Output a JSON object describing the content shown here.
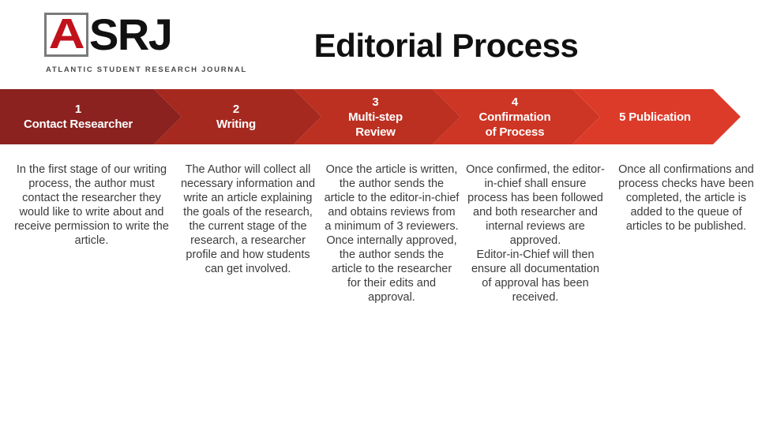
{
  "header": {
    "logo": {
      "letter_box": "A",
      "wordmark": "SRJ",
      "subtitle": "ATLANTIC STUDENT RESEARCH JOURNAL",
      "box_letter_color": "#C1121C",
      "wordmark_color": "#111111",
      "box_border_color": "#7A7A7A"
    },
    "title": "Editorial Process"
  },
  "process": {
    "steps": [
      {
        "number": "1",
        "title": "Contact Researcher",
        "header_text": "1\nContact Researcher",
        "color": "#8B2220",
        "body": "In the first stage of our writing process, the author must contact the researcher they would like to write about and receive permission to write the article."
      },
      {
        "number": "2",
        "title": "Writing",
        "header_text": "2\nWriting",
        "color": "#A5291F",
        "body": "The Author will collect all necessary information and write an article explaining the goals of the research, the current stage of the research, a researcher profile and how students can get involved."
      },
      {
        "number": "3",
        "title": "Multi-step Review",
        "header_text": "3\nMulti-step\nReview",
        "color": "#BB3021",
        "body": "Once the article is written, the author sends the article to the editor-in-chief and obtains reviews from a minimum of 3 reviewers. Once internally approved, the author sends the article to the researcher for their edits and approval."
      },
      {
        "number": "4",
        "title": "Confirmation of Process",
        "header_text": "4\nConfirmation\nof Process",
        "color": "#CD3524",
        "body": "Once confirmed, the editor-in-chief shall ensure process has been followed and both researcher and internal reviews are approved.\nEditor-in-Chief will then ensure all documentation of approval has been received."
      },
      {
        "number": "5",
        "title": "Publication",
        "header_text": "5 Publication",
        "color": "#DD3B2A",
        "body": "Once all confirmations and process checks have been completed, the article is added to the queue of articles to be published."
      }
    ]
  },
  "colors": {
    "background": "#FFFFFF",
    "body_text": "#3B3B3B",
    "header_text": "#111111",
    "chevron_text": "#FFFFFF"
  }
}
